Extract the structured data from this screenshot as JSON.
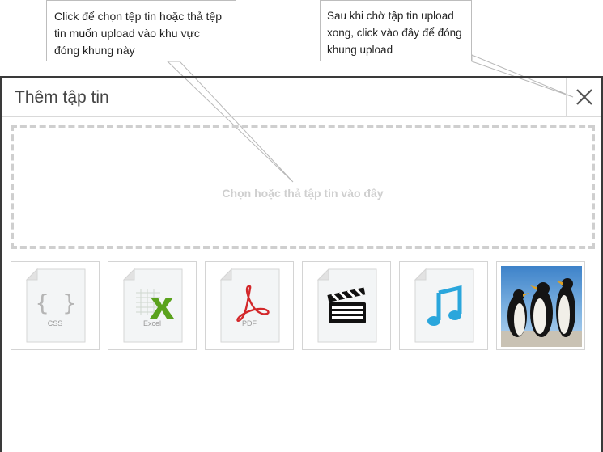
{
  "callouts": {
    "drop_hint": "Click để chọn tệp tin hoặc thả tệp tin muốn upload vào khu vực đóng khung này",
    "close_hint": "Sau khi chờ tập tin upload xong, click vào đây để đóng khung upload"
  },
  "dialog": {
    "title": "Thêm tập tin",
    "close_icon": "close-icon",
    "dropzone_text": "Chọn hoặc thả tập tin vào đây"
  },
  "thumbnails": [
    {
      "type": "css",
      "label": "CSS",
      "icon": "css-file-icon"
    },
    {
      "type": "excel",
      "label": "Excel",
      "icon": "excel-file-icon"
    },
    {
      "type": "pdf",
      "label": "PDF",
      "icon": "pdf-file-icon"
    },
    {
      "type": "video",
      "label": "",
      "icon": "video-file-icon"
    },
    {
      "type": "audio",
      "label": "",
      "icon": "audio-file-icon"
    },
    {
      "type": "image",
      "label": "",
      "icon": "penguins-image"
    }
  ],
  "colors": {
    "excel_green": "#5aa21d",
    "pdf_red": "#d3282b",
    "audio_blue": "#2aa6dc"
  }
}
